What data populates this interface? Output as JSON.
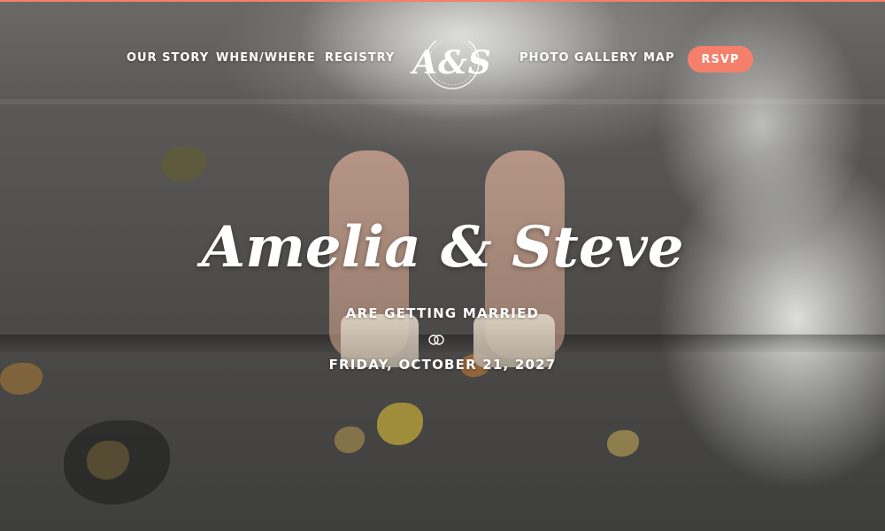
{
  "nav": {
    "left": [
      {
        "label": "OUR STORY"
      },
      {
        "label": "WHEN/WHERE"
      },
      {
        "label": "REGISTRY"
      }
    ],
    "logo_text": "A&S",
    "right": [
      {
        "label": "PHOTO GALLERY"
      },
      {
        "label": "MAP"
      }
    ],
    "rsvp_label": "RSVP"
  },
  "hero": {
    "title": "Amelia & Steve",
    "subtitle": "ARE GETTING MARRIED",
    "rings_icon": "wedding-rings-icon",
    "date": "FRIDAY, OCTOBER 21, 2027"
  },
  "colors": {
    "accent": "#f4806c",
    "text": "#ffffff"
  }
}
